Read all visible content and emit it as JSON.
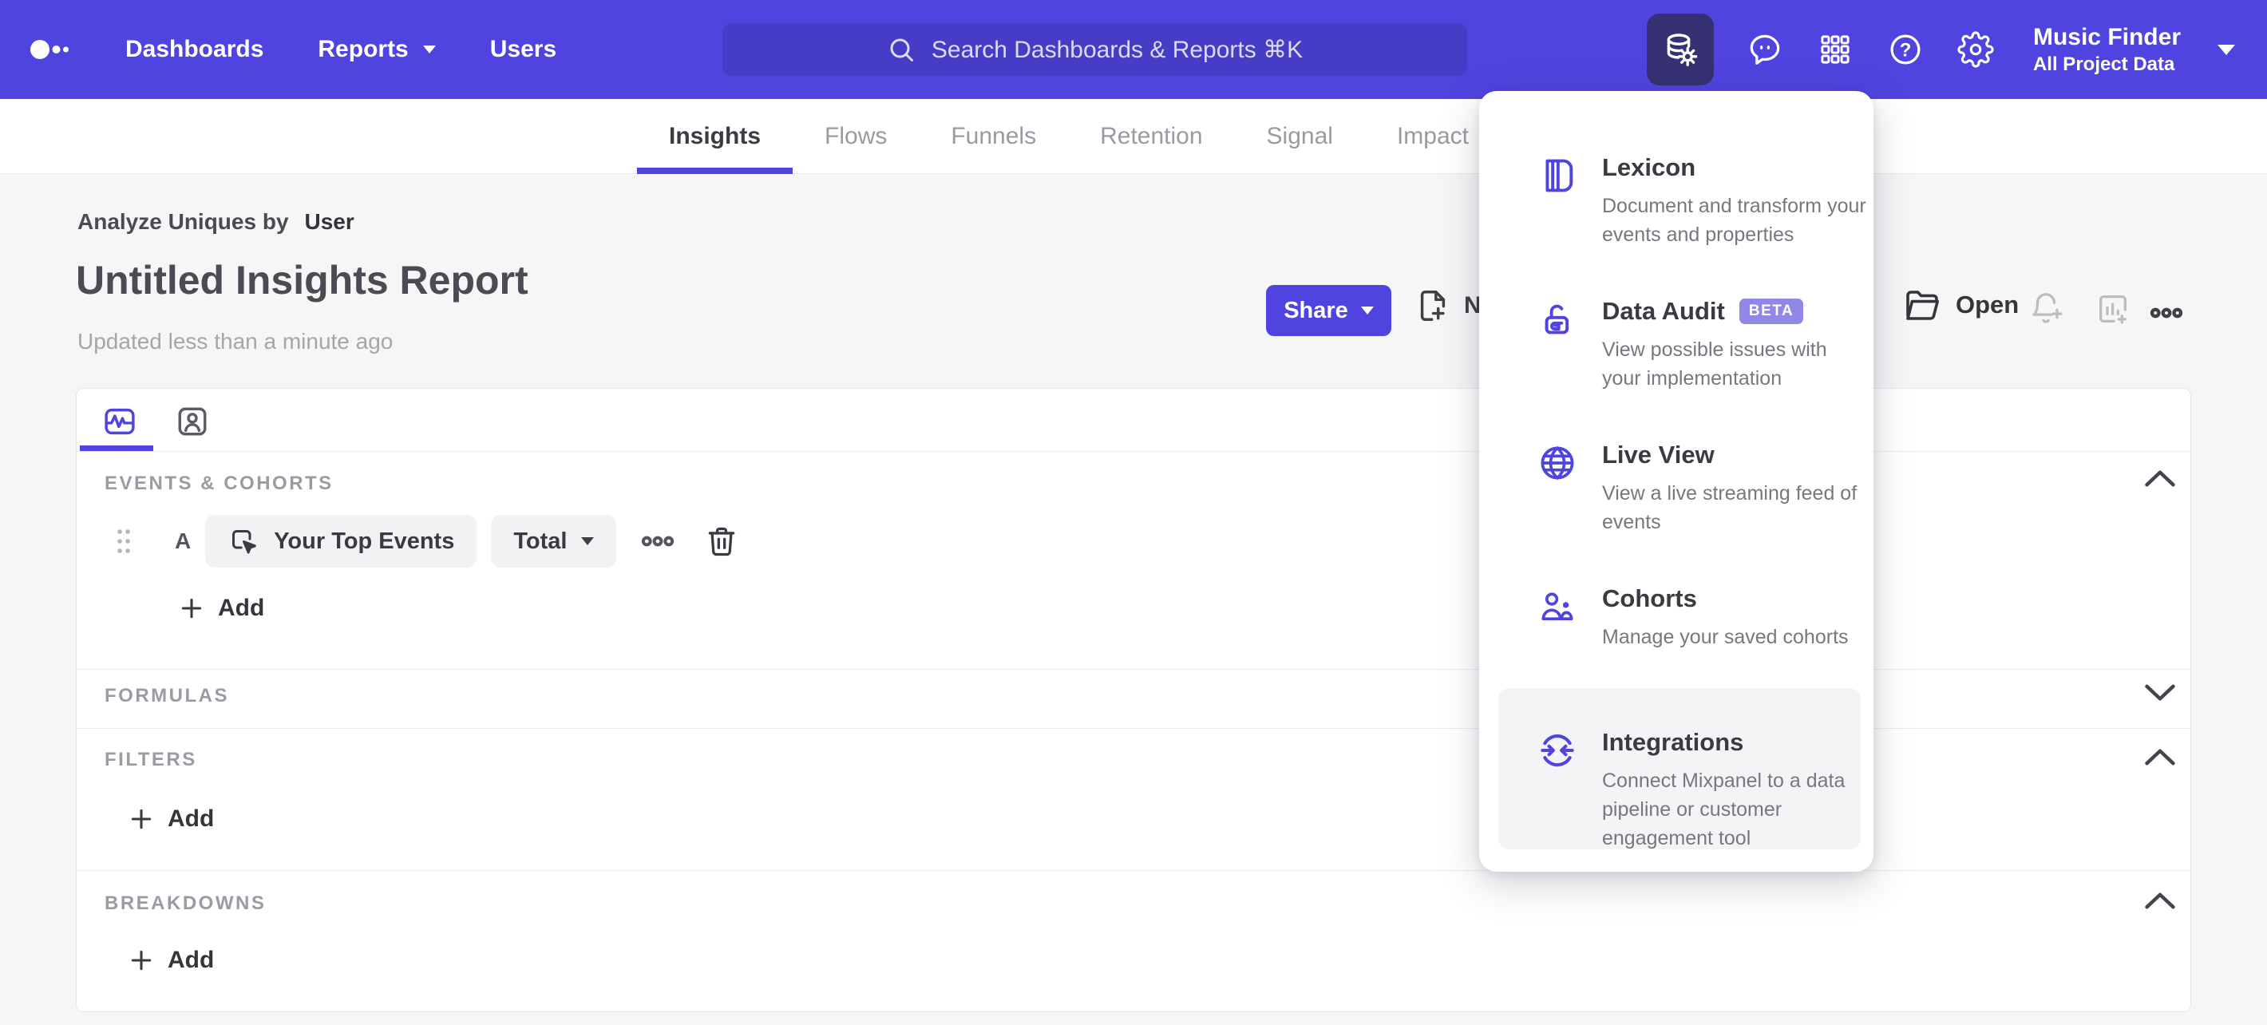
{
  "nav": {
    "items": [
      "Dashboards",
      "Reports",
      "Users"
    ],
    "search": {
      "placeholder": "Search Dashboards & Reports ⌘K"
    },
    "help_glyph": "?",
    "project": {
      "name": "Music Finder",
      "scope": "All Project Data"
    }
  },
  "tabs": [
    {
      "label": "Insights",
      "active": true
    },
    {
      "label": "Flows"
    },
    {
      "label": "Funnels"
    },
    {
      "label": "Retention"
    },
    {
      "label": "Signal"
    },
    {
      "label": "Impact"
    }
  ],
  "header": {
    "analyze_prefix": "Analyze Uniques by",
    "analyze_value": "User",
    "title": "Untitled Insights Report",
    "updated": "Updated less than a minute ago",
    "share": "Share",
    "new": "New",
    "open": "Open"
  },
  "tools_menu": {
    "items": [
      {
        "title": "Lexicon",
        "desc": "Document and transform your events and properties"
      },
      {
        "title": "Data Audit",
        "badge": "BETA",
        "desc": "View possible issues with your implementation"
      },
      {
        "title": "Live View",
        "desc": "View a live streaming feed of events"
      },
      {
        "title": "Cohorts",
        "desc": "Manage your saved cohorts"
      },
      {
        "title": "Integrations",
        "desc": "Connect Mixpanel to a data pipeline or customer engagement tool",
        "highlighted": true
      }
    ]
  },
  "builder": {
    "events": {
      "label": "EVENTS & COHORTS",
      "row": {
        "series_letter": "A",
        "event_name": "Your Top Events",
        "aggregation": "Total"
      },
      "add": "Add"
    },
    "formulas": {
      "label": "FORMULAS"
    },
    "filters": {
      "label": "FILTERS",
      "add": "Add"
    },
    "breakdowns": {
      "label": "BREAKDOWNS",
      "add": "Add"
    }
  },
  "colors": {
    "brand_purple": "#4f44e0",
    "nav_bg": "#4f44df",
    "nav_search_bg": "#453dc6",
    "nav_active_tile": "#363173",
    "beta_badge_bg": "#8f88e8",
    "menu_highlight": "#f4f4f6",
    "page_bg": "#f6f6f7",
    "muted_label": "#9b9ba3"
  }
}
